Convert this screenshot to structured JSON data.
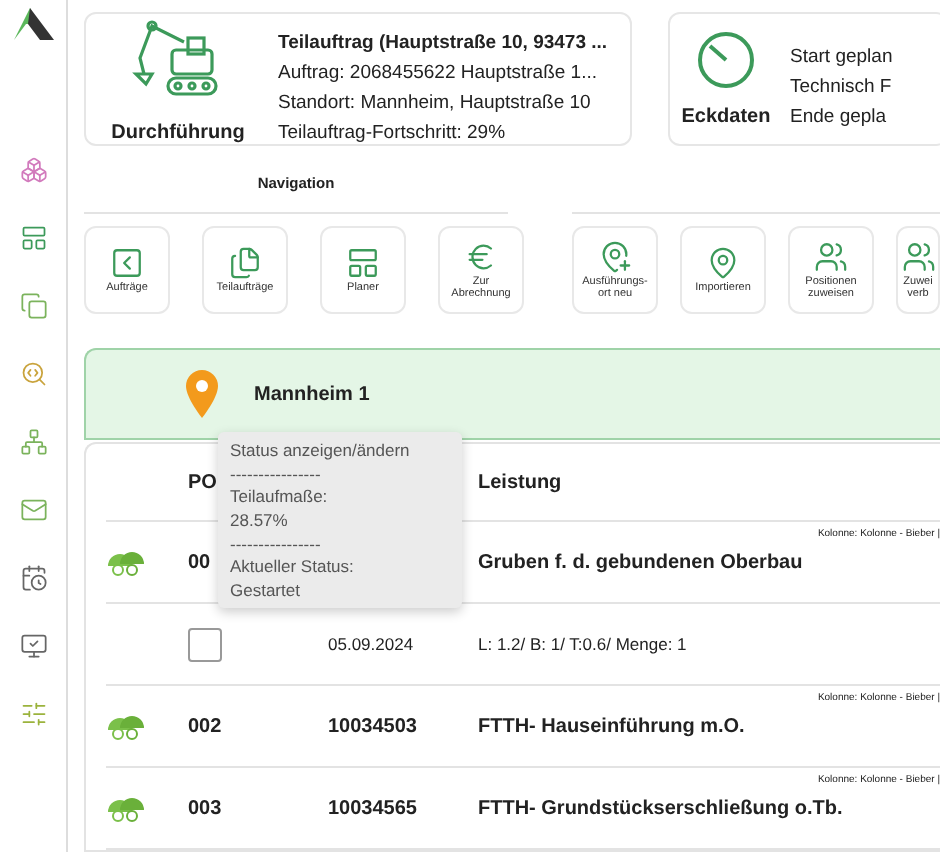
{
  "cards": [
    {
      "kind": "summary",
      "label": "Durchführung",
      "lines": [
        {
          "text": "Teilauftrag (Hauptstraße 10, 93473 ...",
          "bold": true
        },
        {
          "text": "Auftrag: 2068455622 Hauptstraße 1...",
          "bold": false
        },
        {
          "text": "Standort: Mannheim, Hauptstraße 10",
          "bold": false
        },
        {
          "text": "Teilauftrag-Fortschritt: 29%",
          "bold": false
        }
      ]
    },
    {
      "kind": "dates",
      "label": "Eckdaten",
      "lines": [
        {
          "text": "Start geplan",
          "bold": false
        },
        {
          "text": "Technisch F",
          "bold": false
        },
        {
          "text": "Ende gepla",
          "bold": false
        }
      ]
    }
  ],
  "navigation": {
    "title": "Navigation",
    "buttons": [
      {
        "label": "Aufträge"
      },
      {
        "label": "Teilaufträge"
      },
      {
        "label": "Planer"
      },
      {
        "label": "Zur Abrechnung"
      }
    ]
  },
  "actions": {
    "buttons": [
      {
        "label": "Ausführungs-ort neu"
      },
      {
        "label": "Importieren"
      },
      {
        "label": "Positionen zuweisen"
      },
      {
        "label": "Zuwei verb"
      }
    ]
  },
  "location": {
    "name": "Mannheim 1"
  },
  "table": {
    "columns": [
      "PO",
      "Leistung"
    ],
    "rows": [
      {
        "kind": "position",
        "number": "00",
        "code": "",
        "title": "Gruben f. d. gebundenen Oberbau",
        "meta": "Kolonne: Kolonne - Bieber |"
      },
      {
        "kind": "measure",
        "checked": false,
        "date": "05.09.2024",
        "detail": "L: 1.2/ B: 1/ T:0.6/ Menge: 1"
      },
      {
        "kind": "position",
        "number": "002",
        "code": "10034503",
        "title": "FTTH- Hauseinführung m.O.",
        "meta": "Kolonne: Kolonne - Bieber |"
      },
      {
        "kind": "position",
        "number": "003",
        "code": "10034565",
        "title": "FTTH- Grundstückserschließung o.Tb.",
        "meta": "Kolonne: Kolonne - Bieber |"
      }
    ]
  },
  "tooltip": {
    "lines": [
      "Status anzeigen/ändern",
      "----------------",
      "Teilaufmaße:",
      "28.57%",
      "----------------",
      "Aktueller Status:",
      "Gestartet"
    ]
  }
}
